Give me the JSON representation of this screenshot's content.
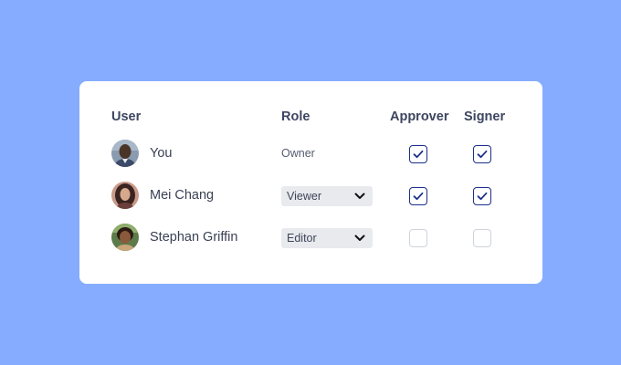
{
  "headers": {
    "user": "User",
    "role": "Role",
    "approver": "Approver",
    "signer": "Signer"
  },
  "rows": [
    {
      "name": "You",
      "role": "Owner",
      "role_editable": false,
      "approver": true,
      "signer": true
    },
    {
      "name": "Mei Chang",
      "role": "Viewer",
      "role_editable": true,
      "approver": true,
      "signer": true
    },
    {
      "name": "Stephan Griffin",
      "role": "Editor",
      "role_editable": true,
      "approver": false,
      "signer": false
    }
  ],
  "colors": {
    "background": "#86acff",
    "card": "#ffffff",
    "checkbox_checked": "#1b2f8c",
    "checkbox_unchecked_border": "#cfd3dc",
    "select_bg": "#e8eaee"
  },
  "icons": {
    "check": "check-icon",
    "dropdown": "chevron-down-icon"
  }
}
